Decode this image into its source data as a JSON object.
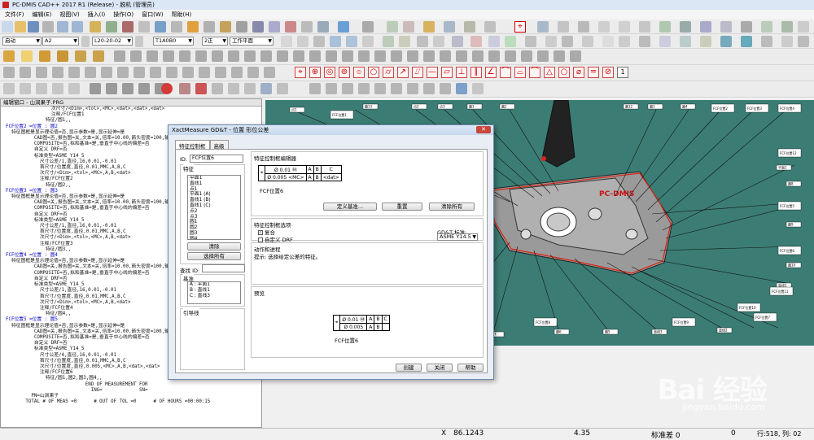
{
  "window": {
    "title": "PC-DMIS CAD++ 2017 R1 (Release) - 脱机 (管理员)"
  },
  "menu": [
    "文件(F)",
    "编辑(E)",
    "视图(V)",
    "插入(I)",
    "操作(O)",
    "窗口(W)",
    "帮助(H)"
  ],
  "toolbar": {
    "combo1": "启动",
    "combo2": "A2",
    "combo3": "L20-20-02",
    "combo4": "T1A0B0",
    "combo5": "2正",
    "combo6": "工作平面",
    "gdt_page_num": "1"
  },
  "editor": {
    "title": "编辑窗口 - 山涧果子.PRG",
    "lines": [
      "                次尺寸/<Dim>,<tol>,<MC>,<dat>,<dat>,<dat>",
      "                注释/FCF位置1",
      "              特征/圆1,,",
      "FCF位置2 =位置 : 圆2",
      "  特征图框是显示理论值=否,显示参数=是,显示延伸=是",
      "          CAD图=否,报告图=关,文本=关,倍率=10.00,箭头密度=100,输出到=两者,单位=毫米",
      "          COMPOSITE=否,拟和基准=是,垂直于中心线的偏差=否",
      "          自定义 DRF=否",
      "          标准类型=ASME_Y14_5",
      "            尺寸公差/1,直径,16,0.01,-0.01",
      "            首尺寸/位置度,直径,0.01,MMC,A,B,C",
      "            次尺寸/<Dim>,<tol>,<MC>,A,B,<dat>",
      "            注释/FCF位置2",
      "              特征/圆2,,",
      "FCF位置3 =位置 : 圆3",
      "  特征图框是显示理论值=否,显示参数=是,显示延伸=是",
      "          CAD图=关,报告图=关,文本=关,倍率=10.00,箭头密度=100,输出到=两者,单位=毫米",
      "          COMPOSITE=否,拟和基准=是,垂直于中心线的偏差=否",
      "          自定义 DRF=否",
      "          标准类型=ASME_Y14_5",
      "            尺寸公差/1,直径,16,0.01,-0.01",
      "            首尺寸/位置度,直径,0.01,MMC,A,B,C",
      "            次尺寸/<Dim>,<tol>,<MC>,A,B,<dat>",
      "            注释/FCF位置3",
      "              特征/圆3,,",
      "FCF位置4 =位置 : 圆4",
      "  特征图框是显示理论值=否,显示参数=是,显示延伸=是",
      "          CAD图=关,报告图=关,文本=关,倍率=10.00,箭头密度=100,输出到=两者,单位=毫米",
      "          COMPOSITE=否,拟和基准=是,垂直于中心线的偏差=否",
      "          自定义 DRF=否",
      "          标准类型=ASME_Y14_5",
      "            尺寸公差/1,直径,16,0.01,-0.01",
      "            首尺寸/位置度,直径,0.01,MMC,A,B,C",
      "            次尺寸/<Dim>,<tol>,<MC>,A,B,<dat>",
      "            注释/FCF位置4",
      "              特征/圆4,,",
      "FCF位置5 =位置 : 圆5",
      "  特征图框是显示理论值=否,显示参数=是,显示延伸=是",
      "          CAD图=关,报告图=关,文本=关,倍率=10.00,箭头密度=100,输出到=两者,单位=毫米",
      "          COMPOSITE=否,拟和基准=是,垂直于中心线的偏差=否",
      "          自定义 DRF=否",
      "          标准类型=ASME_Y14_5",
      "            尺寸公差/4,直径,16,0.01,-0.01",
      "            首尺寸/位置度,直径,0.01,MMC,A,B,C",
      "            次尺寸/位置度,直径,0.005,<MC>,A,B,<dat>,<dat>",
      "            注释/FCF位置6",
      "              特征/圆1,圆2,圆3,圆4,,",
      "                            END OF MEASUREMENT FOR",
      "                              ING=             SN=",
      "         PN=山涧果子",
      "       TOTAL # OF MEAS =0      # OUT OF TOL =0      # OF HOURS =00:00:15"
    ]
  },
  "dialog": {
    "title": "XactMeasure GD&T - 位置 形位公差",
    "close": "✕",
    "tabs": [
      "特征控制框",
      "高级"
    ],
    "id_label": "ID:",
    "id_value": "FCF位置6",
    "feature_group": "特征",
    "features": [
      "平面1",
      "直线1",
      "点1",
      "平面1 (A)",
      "直线1 (B)",
      "直线1 (C)",
      "点2",
      "点3",
      "圆1",
      "圆2",
      "圆3",
      "圆4"
    ],
    "clear_btn": "清除",
    "select_all_btn": "选择所有",
    "find_id_label": "查找 ID:",
    "datum_group": "基准",
    "datums": [
      "A : 平面1",
      "B : 直线1",
      "C : 直线3"
    ],
    "leader_group": "引导线",
    "fcf_editor_group": "特征控制框编辑器",
    "fcf_row1": [
      "⌖",
      "Ø 0.01  Ⓜ",
      "A",
      "B",
      "C"
    ],
    "fcf_row2": [
      "Ø 0.005  <MC>",
      "A",
      "B",
      "<dat>"
    ],
    "fcf_editor_caption": "FCF位置6",
    "define_datum_btn": "定义基准...",
    "reset_btn": "重置",
    "delete_all_btn": "清除所有",
    "options_group": "特征控制框选项",
    "composite_label": "复合",
    "custom_drf_label": "自定义 DRF",
    "gdt_std_label": "GD&T 标准:",
    "gdt_std_value": "ASME Y14.5",
    "action_group": "动作和进程",
    "action_hint": "提示: 选择给定公差的特征。",
    "preview_group": "预览",
    "preview_row1": [
      "⌖",
      "Ø 0.01  Ⓜ",
      "A",
      "B",
      "C"
    ],
    "preview_row2": [
      "Ø 0.005",
      "A",
      "B"
    ],
    "preview_caption": "FCF位置6",
    "create_btn": "创建",
    "close_btn": "关闭",
    "help_btn": "帮助"
  },
  "viewport": {
    "part_label": "PC-DMIS",
    "fcf_tags": [
      "FCF位置1",
      "FCF位置2",
      "FCF位置3",
      "FCF位置4",
      "FCF位置5",
      "FCF位置6",
      "FCF位置7",
      "FCF位置8",
      "FCF位置9",
      "FCF位置10",
      "FCF位置11",
      "FCF位置12"
    ],
    "feature_tags": [
      "点1",
      "点2",
      "点3",
      "圆1",
      "圆2",
      "圆3",
      "圆4",
      "平面1",
      "直线1",
      "直线2",
      "直线3",
      "圆5",
      "圆6",
      "圆7",
      "圆8",
      "圆9",
      "圆10",
      "圆11",
      "圆12",
      "圆13"
    ]
  },
  "status": {
    "x_label": "X",
    "x_value": "86.1243",
    "y_value": "4.35",
    "std_dev_label": "标准差 0",
    "zero": "0",
    "line_col": "行:518, 列: 02"
  },
  "watermark": {
    "main": "Bai 经验",
    "url": "jingyan.baidu.com"
  }
}
